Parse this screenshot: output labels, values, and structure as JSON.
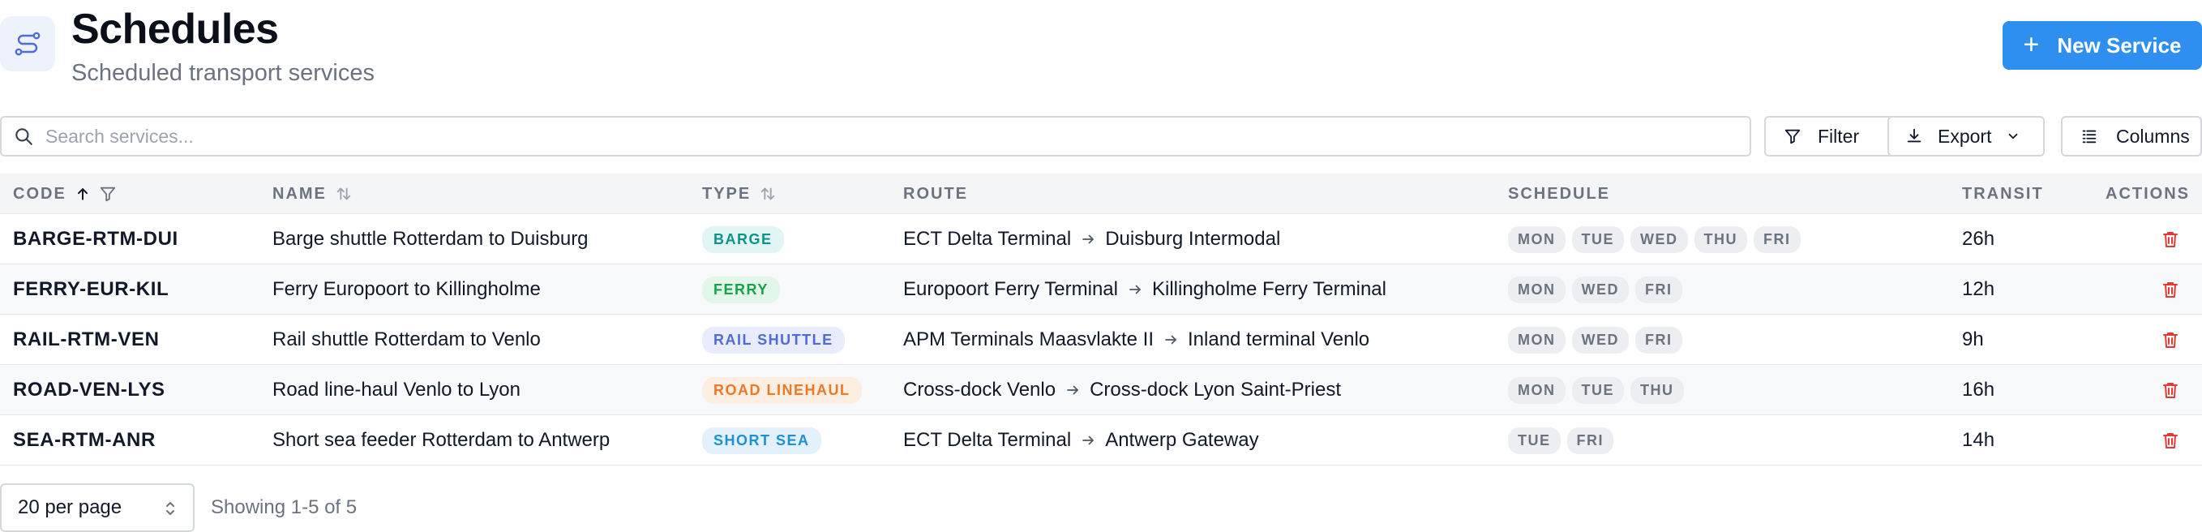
{
  "header": {
    "title": "Schedules",
    "subtitle": "Scheduled transport services",
    "app_icon": "route-icon",
    "new_button": {
      "label": "New Service",
      "icon": "plus-icon",
      "color": "#2f8ff0"
    }
  },
  "toolbar": {
    "search_placeholder": "Search services...",
    "search_value": "",
    "filter_label": "Filter",
    "export_label": "Export",
    "columns_label": "Columns"
  },
  "table": {
    "columns": {
      "code": "CODE",
      "name": "NAME",
      "type": "TYPE",
      "route": "ROUTE",
      "schedule": "SCHEDULE",
      "transit": "TRANSIT",
      "actions": "ACTIONS"
    },
    "sort": {
      "column": "code",
      "direction": "asc"
    },
    "rows": [
      {
        "code": "BARGE-RTM-DUI",
        "name": "Barge shuttle Rotterdam to Duisburg",
        "type": {
          "label": "BARGE",
          "color": "#0d9488",
          "bg": "#e0f5f4"
        },
        "route_from": "ECT Delta Terminal",
        "route_to": "Duisburg Intermodal",
        "days": [
          "MON",
          "TUE",
          "WED",
          "THU",
          "FRI"
        ],
        "transit": "26h"
      },
      {
        "code": "FERRY-EUR-KIL",
        "name": "Ferry Europoort to Killingholme",
        "type": {
          "label": "FERRY",
          "color": "#16a34a",
          "bg": "#e3f6ea"
        },
        "route_from": "Europoort Ferry Terminal",
        "route_to": "Killingholme Ferry Terminal",
        "days": [
          "MON",
          "WED",
          "FRI"
        ],
        "transit": "12h"
      },
      {
        "code": "RAIL-RTM-VEN",
        "name": "Rail shuttle Rotterdam to Venlo",
        "type": {
          "label": "RAIL SHUTTLE",
          "color": "#4f6bdb",
          "bg": "#e8ecfc"
        },
        "route_from": "APM Terminals Maasvlakte II",
        "route_to": "Inland terminal Venlo",
        "days": [
          "MON",
          "WED",
          "FRI"
        ],
        "transit": "9h"
      },
      {
        "code": "ROAD-VEN-LYS",
        "name": "Road line-haul Venlo to Lyon",
        "type": {
          "label": "ROAD LINEHAUL",
          "color": "#ea7a2a",
          "bg": "#fdeee2"
        },
        "route_from": "Cross-dock Venlo",
        "route_to": "Cross-dock Lyon Saint-Priest",
        "days": [
          "MON",
          "TUE",
          "THU"
        ],
        "transit": "16h"
      },
      {
        "code": "SEA-RTM-ANR",
        "name": "Short sea feeder Rotterdam to Antwerp",
        "type": {
          "label": "SHORT SEA",
          "color": "#1f8fd6",
          "bg": "#e2f1fb"
        },
        "route_from": "ECT Delta Terminal",
        "route_to": "Antwerp Gateway",
        "days": [
          "TUE",
          "FRI"
        ],
        "transit": "14h"
      }
    ],
    "row_action_icon": "trash-icon",
    "delete_color": "#e53935"
  },
  "footer": {
    "per_page": "20 per page",
    "showing": "Showing 1-5 of 5"
  }
}
